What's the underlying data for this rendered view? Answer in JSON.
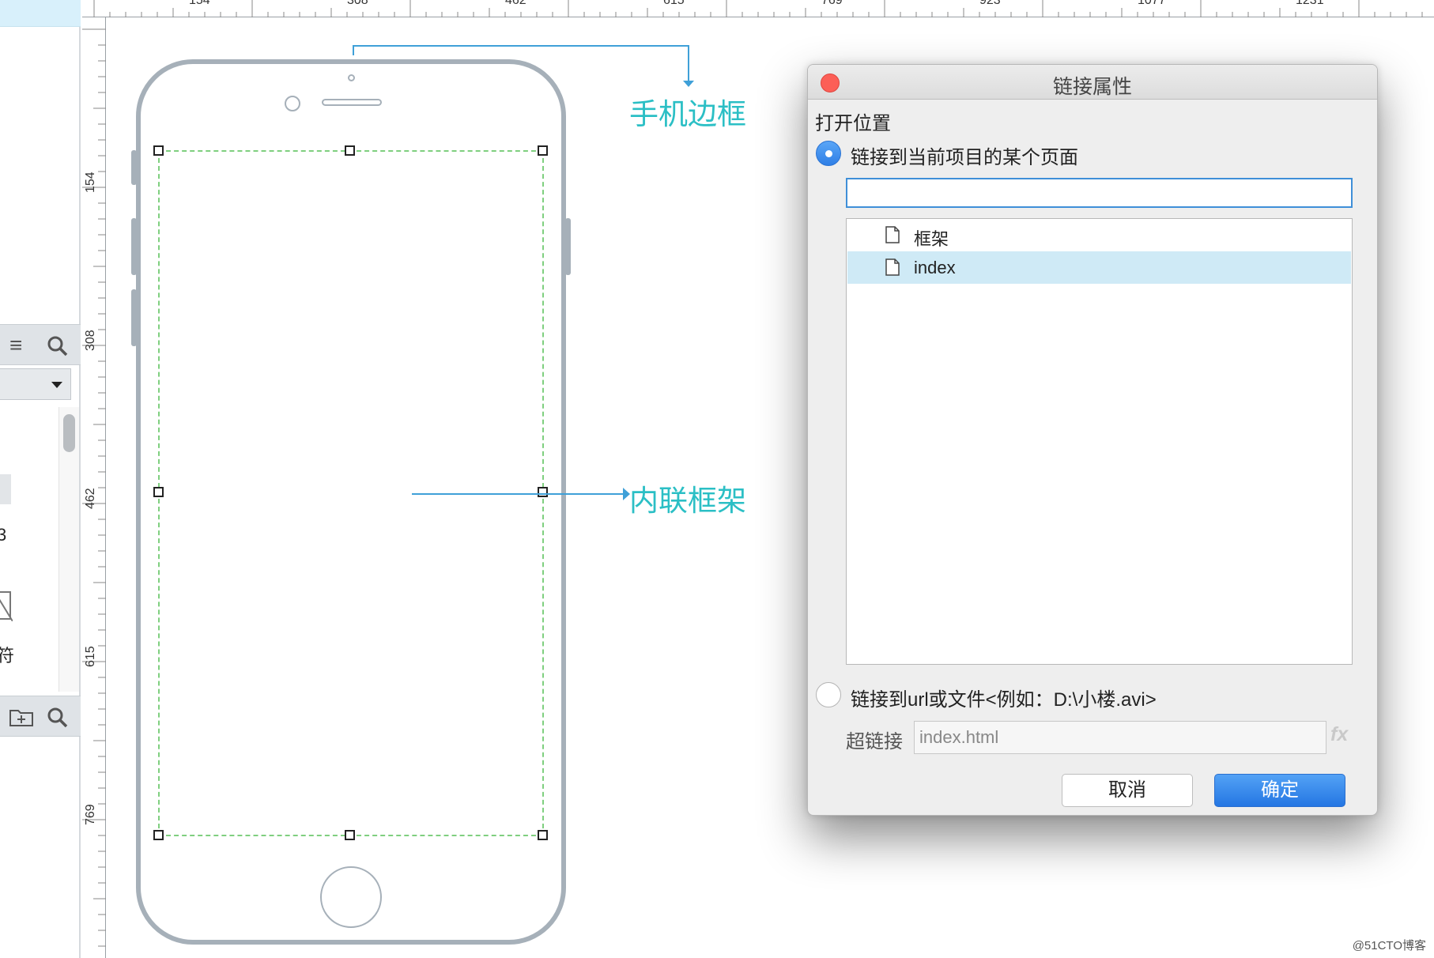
{
  "left_panel": {
    "text_partial_1": "3",
    "text_partial_2": "符"
  },
  "ruler": {
    "top_labels": [
      "154",
      "308",
      "462",
      "615",
      "769",
      "923",
      "1077",
      "1231"
    ],
    "left_labels": [
      "154",
      "308",
      "462",
      "615",
      "769"
    ]
  },
  "annotations": {
    "phone_border": "手机边框",
    "inline_frame": "内联框架"
  },
  "dialog": {
    "title": "链接属性",
    "section_label": "打开位置",
    "option_page": "链接到当前项目的某个页面",
    "search_value": "",
    "pages": [
      {
        "label": "框架",
        "selected": false
      },
      {
        "label": "index",
        "selected": true
      }
    ],
    "option_url": "链接到url或文件<例如：D:\\小楼.avi>",
    "hyperlink_label": "超链接",
    "hyperlink_value": "index.html",
    "fx_label": "fx",
    "cancel_label": "取消",
    "ok_label": "确定",
    "selected_option": "page"
  },
  "colors": {
    "annotation": "#2bbfc5",
    "accent": "#3f8fd8",
    "selection": "#cfeaf6",
    "close": "#fc5f57"
  },
  "watermark": "@51CTO博客"
}
